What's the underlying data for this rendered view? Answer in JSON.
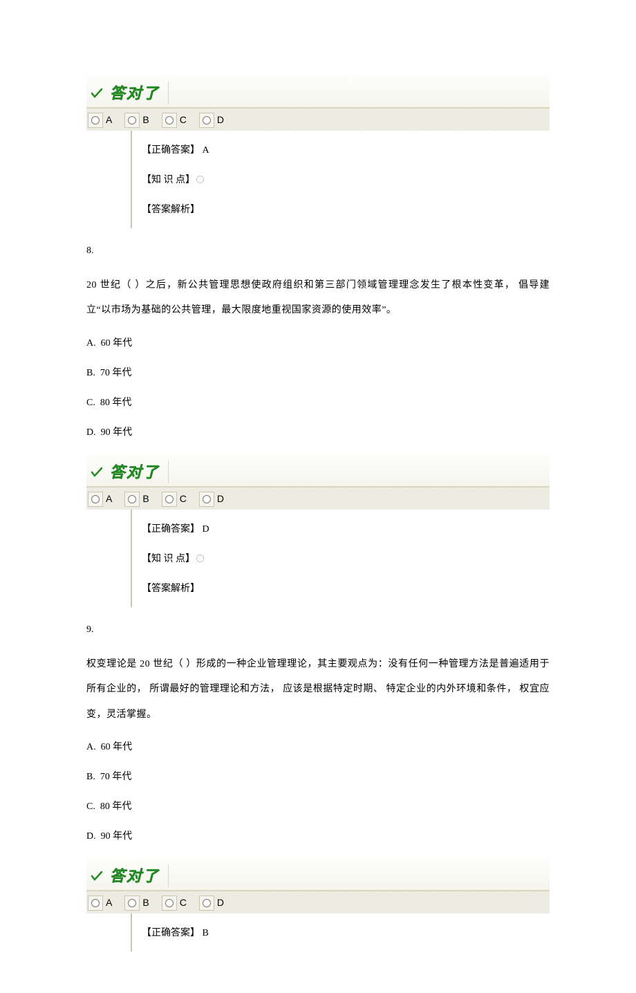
{
  "labels": {
    "correct_banner": "答对了",
    "correct_answer_label": "【正确答案】",
    "knowledge_label": "【知 识 点】",
    "analysis_label": "【答案解析】",
    "optA": "A",
    "optB": "B",
    "optC": "C",
    "optD": "D"
  },
  "q7_tail": {
    "correct_answer": "A"
  },
  "q8": {
    "number": "8.",
    "text": "20 世纪（  ）之后，新公共管理思想使政府组织和第三部门领域管理理念发生了根本性变革，        倡导建立“以市场为基础的公共管理，最大限度地重视国家资源的使用效率”。",
    "options": {
      "A": "A.  60 年代",
      "B": "B.  70 年代",
      "C": "C.  80 年代",
      "D": "D.  90 年代"
    },
    "correct_answer": "D"
  },
  "q9": {
    "number": "9.",
    "text": "权变理论是   20 世纪（  ）形成的一种企业管理理论，其主要观点为：没有任何一种管理方法是普遍适用于所有企业的， 所谓最好的管理理论和方法，   应该是根据特定时期、  特定企业的内外环境和条件，   权宜应变，灵活掌握。",
    "options": {
      "A": "A.  60 年代",
      "B": "B.  70 年代",
      "C": "C.  80 年代",
      "D": "D.  90 年代"
    },
    "correct_answer": "B"
  }
}
